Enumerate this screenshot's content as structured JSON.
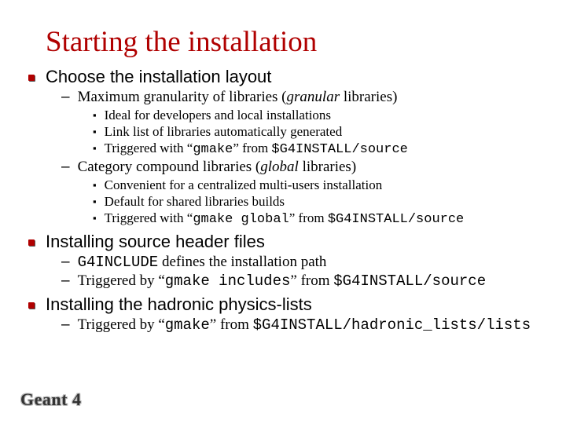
{
  "title": "Starting the installation",
  "sections": [
    {
      "heading": "Choose the installation layout",
      "subs": [
        {
          "text_html": "Maximum granularity of libraries (<span class='ital'>granular</span> libraries)",
          "points": [
            {
              "text_html": "Ideal for developers and local installations"
            },
            {
              "text_html": "Link list of libraries automatically generated"
            },
            {
              "text_html": "Triggered with “<span class='mono'>gmake</span>” from <span class='mono'>$G4INSTALL/source</span>"
            }
          ]
        },
        {
          "text_html": "Category compound libraries (<span class='ital'>global</span> libraries)",
          "points": [
            {
              "text_html": "Convenient for a centralized multi-users installation"
            },
            {
              "text_html": "Default for shared libraries builds"
            },
            {
              "text_html": "Triggered with “<span class='mono'>gmake global</span>” from <span class='mono'>$G4INSTALL/source</span>"
            }
          ]
        }
      ]
    },
    {
      "heading": "Installing source header files",
      "subs": [
        {
          "text_html": "<span class='mono'>G4INCLUDE</span> defines the installation path"
        },
        {
          "text_html": "Triggered by “<span class='mono'>gmake includes</span>” from <span class='mono'>$G4INSTALL/source</span>"
        }
      ]
    },
    {
      "heading": "Installing the hadronic physics-lists",
      "subs": [
        {
          "text_html": "Triggered by “<span class='mono'>gmake</span>” from <span class='mono'>$G4INSTALL/hadronic_lists/lists</span>"
        }
      ]
    }
  ],
  "footer": "Geant 4"
}
